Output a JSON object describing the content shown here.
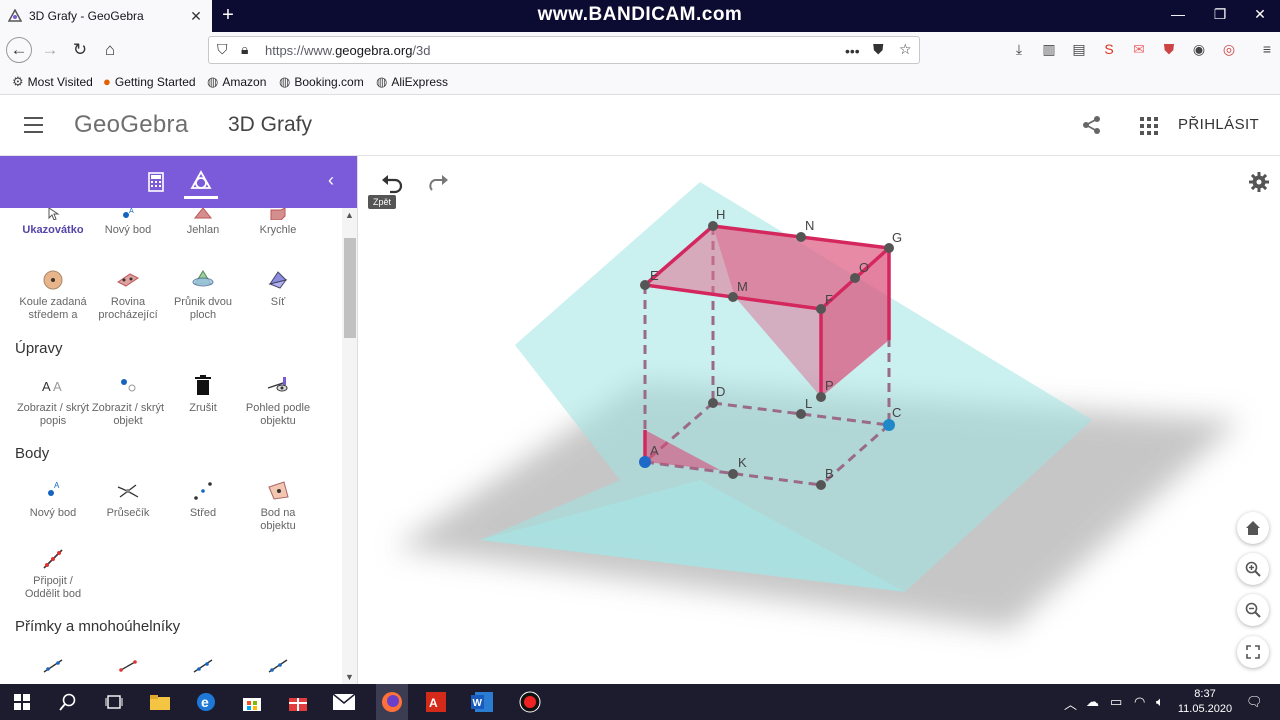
{
  "browser": {
    "tab_title": "3D Grafy - GeoGebra",
    "tab_close": "✕",
    "new_tab": "+",
    "watermark": "www.BANDICAM.com",
    "url_prefix": "https://www.",
    "url_domain": "geogebra.org",
    "url_path": "/3d",
    "page_actions": "•••",
    "bookmarks": [
      {
        "label": "Most Visited",
        "icon": "gear-icon"
      },
      {
        "label": "Getting Started",
        "icon": "firefox-icon"
      },
      {
        "label": "Amazon",
        "icon": "globe-icon"
      },
      {
        "label": "Booking.com",
        "icon": "globe-icon"
      },
      {
        "label": "AliExpress",
        "icon": "globe-icon"
      }
    ]
  },
  "app": {
    "logo": "GeoGebra",
    "title": "3D Grafy",
    "signin": "PŘIHLÁSIT"
  },
  "toolbar": {
    "top_row": [
      "Ukazovátko",
      "Nový bod",
      "Jehlan",
      "Krychle"
    ],
    "row2": [
      {
        "line1": "Koule zadaná",
        "line2": "středem a"
      },
      {
        "line1": "Rovina",
        "line2": "procházející"
      },
      {
        "line1": "Průnik dvou",
        "line2": "ploch"
      },
      {
        "line1": "Síť",
        "line2": ""
      }
    ],
    "categories": {
      "upravy": "Úpravy",
      "body": "Body",
      "primky": "Přímky a mnohoúhelníky"
    },
    "upravy_tools": [
      {
        "line1": "Zobrazit / skrýt",
        "line2": "popis"
      },
      {
        "line1": "Zobrazit / skrýt",
        "line2": "objekt"
      },
      {
        "line1": "Zrušit",
        "line2": ""
      },
      {
        "line1": "Pohled podle",
        "line2": "objektu"
      }
    ],
    "body_tools": [
      {
        "line1": "Nový bod",
        "line2": ""
      },
      {
        "line1": "Průsečík",
        "line2": ""
      },
      {
        "line1": "Střed",
        "line2": ""
      },
      {
        "line1": "Bod na",
        "line2": "objektu"
      }
    ],
    "body_tools2": [
      {
        "line1": "Připojit /",
        "line2": "Oddělit bod"
      }
    ]
  },
  "graphics": {
    "tooltip": "Zpět",
    "points": [
      "H",
      "N",
      "G",
      "E",
      "M",
      "F",
      "D",
      "L",
      "C",
      "A",
      "K",
      "B",
      "O",
      "P"
    ]
  },
  "taskbar": {
    "time": "8:37",
    "date": "11.05.2020"
  }
}
